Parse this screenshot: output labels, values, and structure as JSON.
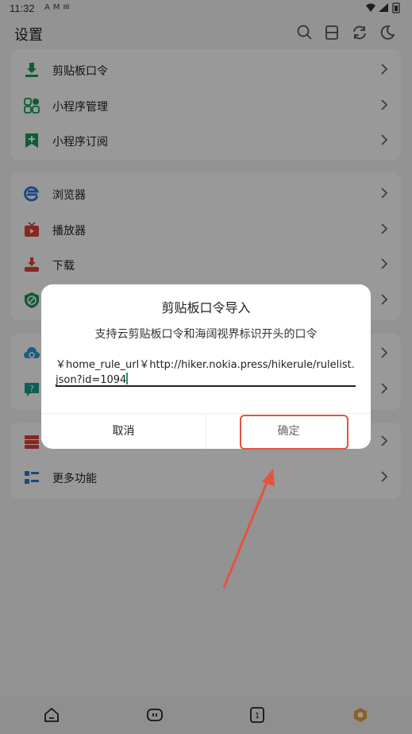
{
  "status_bar": {
    "time": "11:32",
    "notification_icons": [
      "A",
      "M",
      "✉"
    ]
  },
  "header": {
    "title": "设置",
    "icons": [
      "search-icon",
      "layout-icon",
      "refresh-icon",
      "night-mode-icon"
    ]
  },
  "card1": {
    "items": [
      {
        "label": "剪贴板口令",
        "icon": "download-icon",
        "color": "#1a9a5a"
      },
      {
        "label": "小程序管理",
        "icon": "apps-grid-icon",
        "color": "#1a9a5a"
      },
      {
        "label": "小程序订阅",
        "icon": "bookmark-add-icon",
        "color": "#1a9a5a"
      }
    ]
  },
  "card2": {
    "items": [
      {
        "label": "浏览器",
        "icon": "browser-icon",
        "color": "#2b7bd8"
      },
      {
        "label": "播放器",
        "icon": "tv-icon",
        "color": "#e0413a"
      },
      {
        "label": "下载",
        "icon": "download-tray-icon",
        "color": "#e0413a"
      },
      {
        "label": "",
        "icon": "shield-check-icon",
        "color": "#1a9a5a"
      }
    ]
  },
  "card3": {
    "items": [
      {
        "label": "",
        "icon": "cloud-sync-icon",
        "color": "#2b9ad8"
      },
      {
        "label": "",
        "icon": "help-chat-icon",
        "color": "#1a9a8a"
      }
    ]
  },
  "card4": {
    "items": [
      {
        "label": "",
        "icon": "server-icon",
        "color": "#e0413a"
      },
      {
        "label": "更多功能",
        "icon": "list-icon",
        "color": "#2b7bd8"
      }
    ]
  },
  "dialog": {
    "title": "剪贴板口令导入",
    "subtitle": "支持云剪贴板口令和海阔视界标识开头的口令",
    "input_value": "￥home_rule_url￥http://hiker.nokia.press/hikerule/rulelist.json?id=1094",
    "cancel_label": "取消",
    "confirm_label": "确定"
  },
  "colors": {
    "accent": "#1a9a5a",
    "highlight": "#e5533c",
    "overlay": "rgba(0,0,0,0.4)"
  },
  "bottom_nav": {
    "items": [
      "home-icon",
      "gamepad-icon",
      "tab-count-icon",
      "profile-hex-icon"
    ]
  }
}
